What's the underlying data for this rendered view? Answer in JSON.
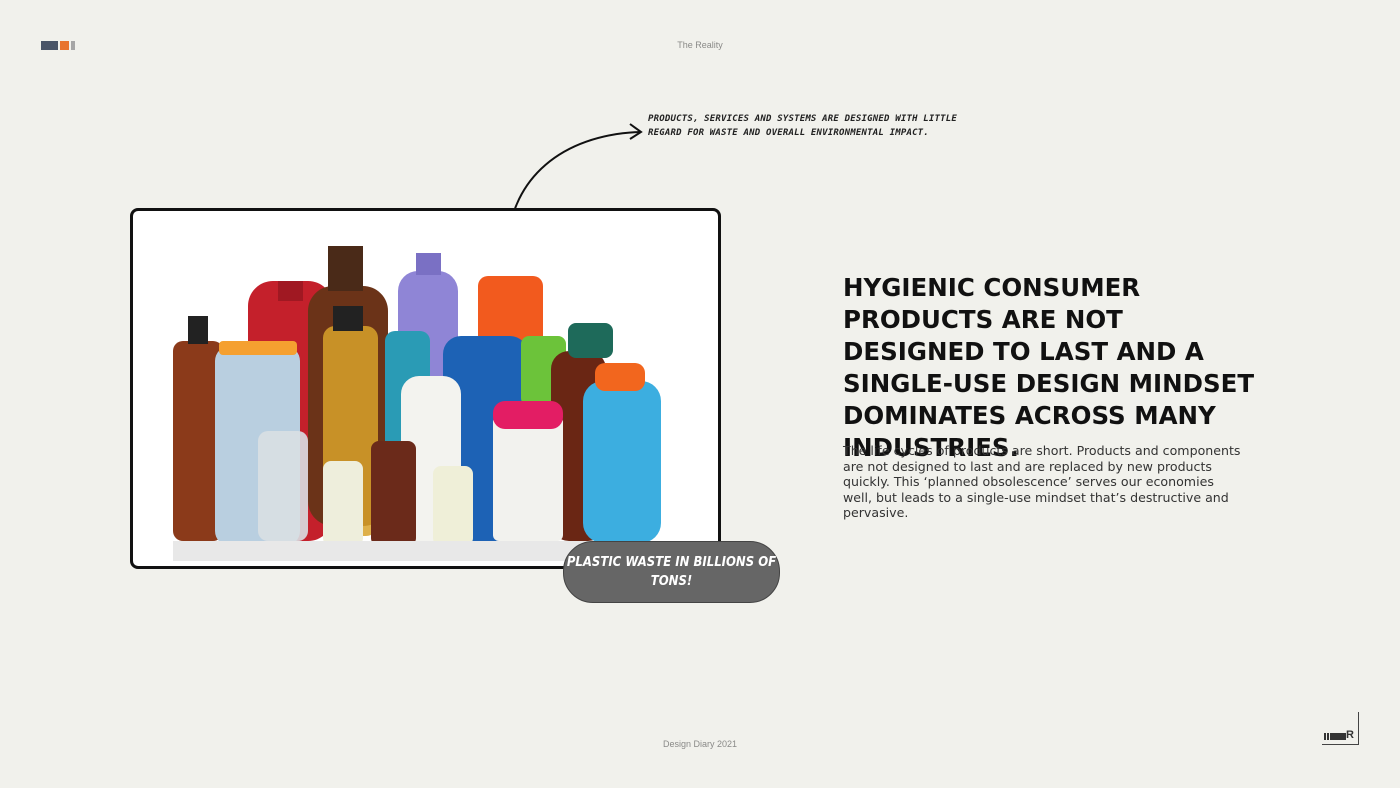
{
  "header": {
    "title": "The Reality"
  },
  "footer": {
    "text": "Design Diary 2021"
  },
  "logo": {
    "colors": [
      "#4a5568",
      "#e8742f",
      "#a6a6a6"
    ],
    "mark_letter": "R"
  },
  "annotation": {
    "text": "Products, services and systems are designed with little regard for waste and overall environmental impact."
  },
  "callout": {
    "text": "Plastic waste in billions of tons!"
  },
  "headline": "Hygienic consumer products are not designed to last and a single-use design mindset dominates across many industries.",
  "body": "The life cycles of products are short. Products and components are not designed to last and are replaced by new products quickly. This ‘planned obsolescence’ serves our economies well, but leads to a single-use mindset that’s destructive and pervasive."
}
